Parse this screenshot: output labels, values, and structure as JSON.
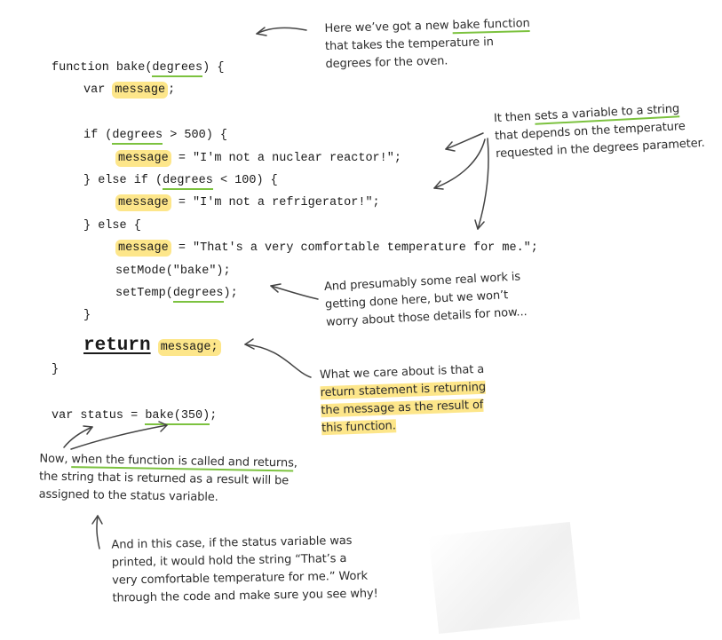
{
  "code": {
    "l1_a": "function bake(",
    "l1_b": "degrees",
    "l1_c": ") {",
    "l2_a": "var ",
    "l2_b": "message",
    "l2_c": ";",
    "l3_a": "if (",
    "l3_b": "degrees",
    "l3_c": " > 500) {",
    "l4_b": "message",
    "l4_c": " = \"I'm not a nuclear reactor!\";",
    "l5_a": "} else if (",
    "l5_b": "degrees",
    "l5_c": " < 100) {",
    "l6_b": "message",
    "l6_c": " = \"I'm not a refrigerator!\";",
    "l7": "} else {",
    "l8_b": "message",
    "l8_c": " = \"That's a very comfortable temperature for me.\";",
    "l9": "setMode(\"bake\");",
    "l10_a": "setTemp(",
    "l10_b": "degrees",
    "l10_c": ");",
    "l11": "}",
    "l12_a": "return",
    "l12_b": "message;",
    "l13": "}",
    "l14_a": "var status = ",
    "l14_b": "bake(350)",
    "l14_c": ";"
  },
  "notes": {
    "n1_a": "Here we’ve got a new ",
    "n1_b": "bake function",
    "n1_c": "that takes the temperature in",
    "n1_d": "degrees for the oven.",
    "n2_a": "It then ",
    "n2_b": "sets a variable to a string",
    "n2_c": "that depends on the temperature",
    "n2_d": "requested in the degrees parameter.",
    "n3_a": "And presumably some real work is",
    "n3_b": "getting done here, but we won’t",
    "n3_c": "worry about those details for now...",
    "n4_a": "What we care about is that a",
    "n4_b": "return statement is returning",
    "n4_c": "the message as the result of",
    "n4_d": "this function.",
    "n5_a": "Now, ",
    "n5_b": "when the function is called and returns",
    "n5_c": ",",
    "n5_d": "the string that is returned as a result will be",
    "n5_e": "assigned to the status variable.",
    "n6_a": "And in this case, if the status variable was",
    "n6_b": "printed, it would hold the string “That’s a",
    "n6_c": "very comfortable temperature for me.” Work",
    "n6_d": "through the code and make sure you see why!"
  },
  "colors": {
    "highlight": "#fde68a",
    "underline": "#7cc23f",
    "ink": "#1a1a1a"
  }
}
